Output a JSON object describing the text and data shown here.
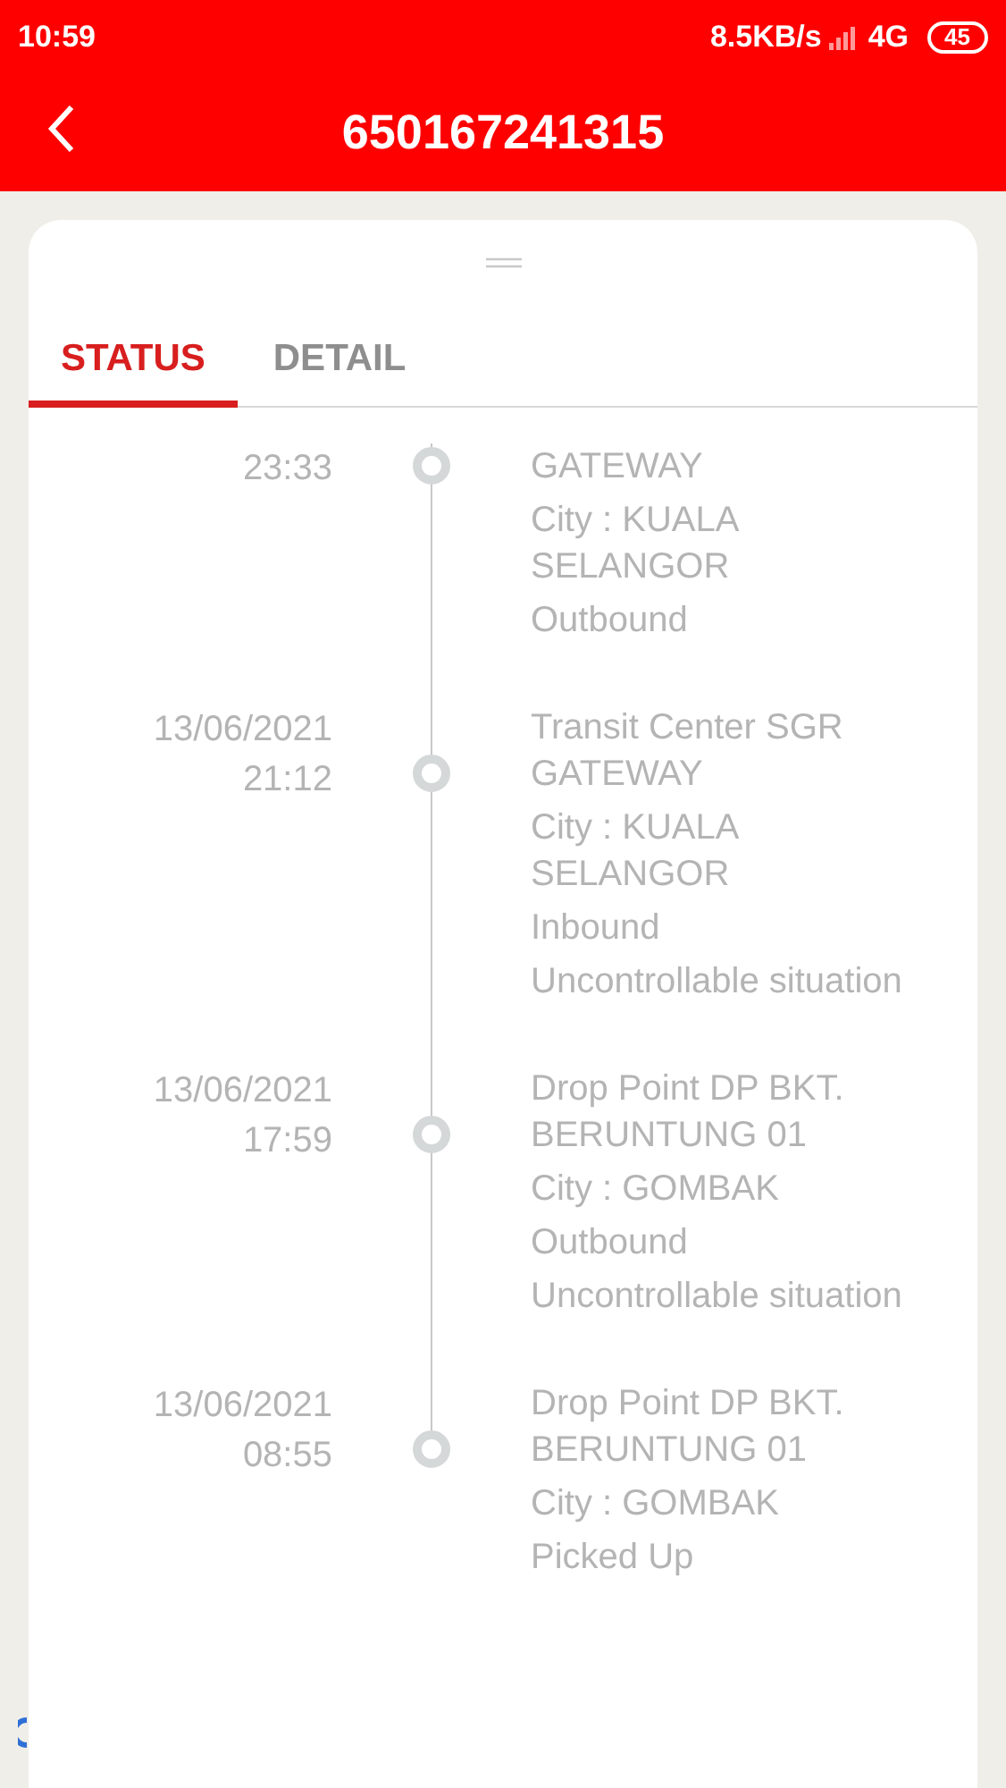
{
  "status_bar": {
    "time": "10:59",
    "speed": "8.5KB/s",
    "network": "4G",
    "battery": "45"
  },
  "header": {
    "title": "650167241315"
  },
  "tabs": [
    {
      "label": "STATUS",
      "selected": true
    },
    {
      "label": "DETAIL",
      "selected": false
    }
  ],
  "events": [
    {
      "time": "23:33",
      "lines": [
        "GATEWAY",
        "City : KUALA SELANGOR",
        "Outbound"
      ]
    },
    {
      "date": "13/06/2021",
      "time": "21:12",
      "lines": [
        "Transit Center SGR GATEWAY",
        "City : KUALA SELANGOR",
        "Inbound",
        "Uncontrollable situation"
      ]
    },
    {
      "date": "13/06/2021",
      "time": "17:59",
      "lines": [
        "Drop Point DP BKT. BERUNTUNG 01",
        "City : GOMBAK",
        "Outbound",
        "Uncontrollable situation"
      ]
    },
    {
      "date": "13/06/2021",
      "time": "08:55",
      "lines": [
        "Drop Point DP BKT. BERUNTUNG 01",
        "City : GOMBAK",
        "Picked Up"
      ]
    }
  ]
}
